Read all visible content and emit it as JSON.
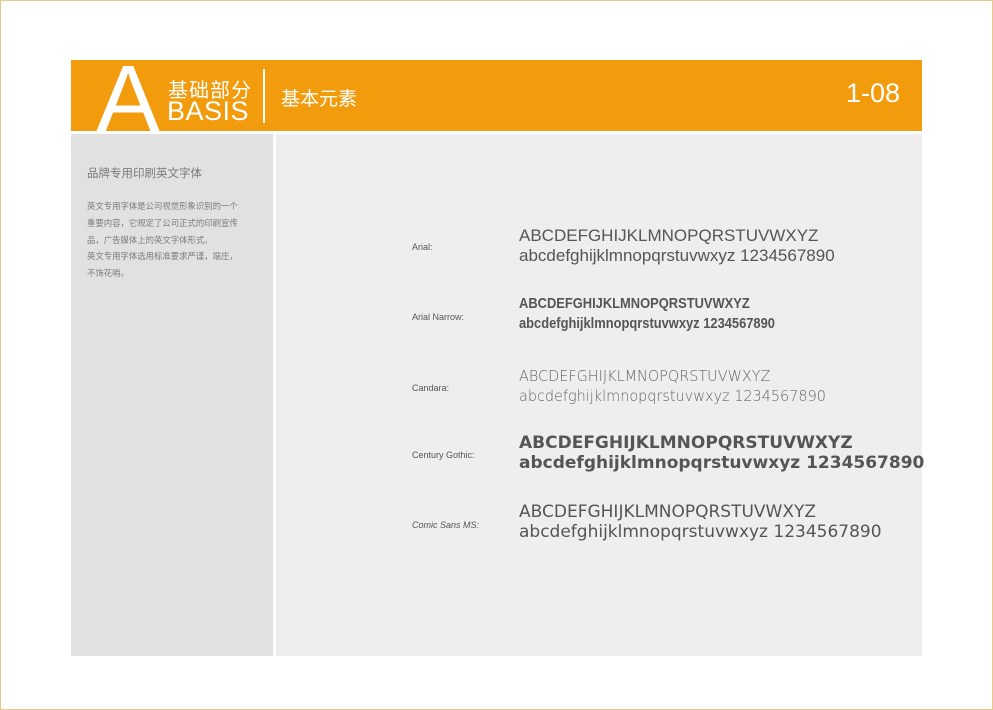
{
  "header": {
    "big_letter": "A",
    "cn_title": "基础部分",
    "en_title": "BASIS",
    "section_title": "基本元素",
    "page_number": "1-08"
  },
  "sidebar": {
    "title": "品牌专用印刷英文字体",
    "description_lines": [
      "英文专用字体是公司视觉形象识别的一个",
      "重要内容，它规定了公司正式的印刷宣传",
      "品，广告媒体上的英文字体形式。",
      "英文专用字体选用标准要求严谨，端庄，",
      "不饰花哨。"
    ]
  },
  "fonts": [
    {
      "name": "Arial:",
      "upper": "ABCDEFGHIJKLMNOPQRSTUVWXYZ",
      "lower": "abcdefghijklmnopqrstuvwxyz  1234567890"
    },
    {
      "name": "Arial Narrow:",
      "upper": "ABCDEFGHIJKLMNOPQRSTUVWXYZ",
      "lower": "abcdefghijklmnopqrstuvwxyz  1234567890"
    },
    {
      "name": "Candara:",
      "upper": "ABCDEFGHIJKLMNOPQRSTUVWXYZ",
      "lower": "abcdefghijklmnopqrstuvwxyz  1234567890"
    },
    {
      "name": "Century Gothic:",
      "upper": "ABCDEFGHIJKLMNOPQRSTUVWXYZ",
      "lower": "abcdefghijklmnopqrstuvwxyz  1234567890"
    },
    {
      "name": "Comic Sans MS:",
      "upper": "ABCDEFGHIJKLMNOPQRSTUVWXYZ",
      "lower": "abcdefghijklmnopqrstuvwxyz  1234567890"
    }
  ],
  "colors": {
    "accent": "#f29b0c",
    "sidebar_bg": "#e1e1e1",
    "main_bg": "#eeeeee",
    "text": "#555555"
  }
}
